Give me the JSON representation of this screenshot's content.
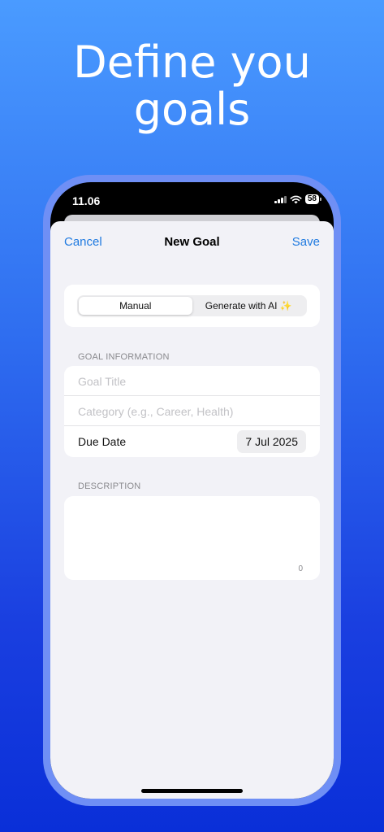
{
  "headline": {
    "line1": "Define you",
    "line2": "goals"
  },
  "status_bar": {
    "time": "11.06",
    "battery": "58"
  },
  "nav": {
    "cancel_label": "Cancel",
    "title": "New Goal",
    "save_label": "Save"
  },
  "mode_selector": {
    "manual_label": "Manual",
    "ai_label": "Generate with AI",
    "ai_icon": "✨",
    "selected": "Manual"
  },
  "goal_information": {
    "section_label": "GOAL INFORMATION",
    "title_placeholder": "Goal Title",
    "category_placeholder": "Category (e.g., Career, Health)",
    "due_date_label": "Due Date",
    "due_date_value": "7 Jul 2025"
  },
  "description": {
    "section_label": "DESCRIPTION",
    "char_count": "0"
  },
  "colors": {
    "accent": "#1f7ae0",
    "sheet_bg": "#f2f2f7",
    "gradient_top": "#4a9bff",
    "gradient_bottom": "#0a2fd8"
  }
}
